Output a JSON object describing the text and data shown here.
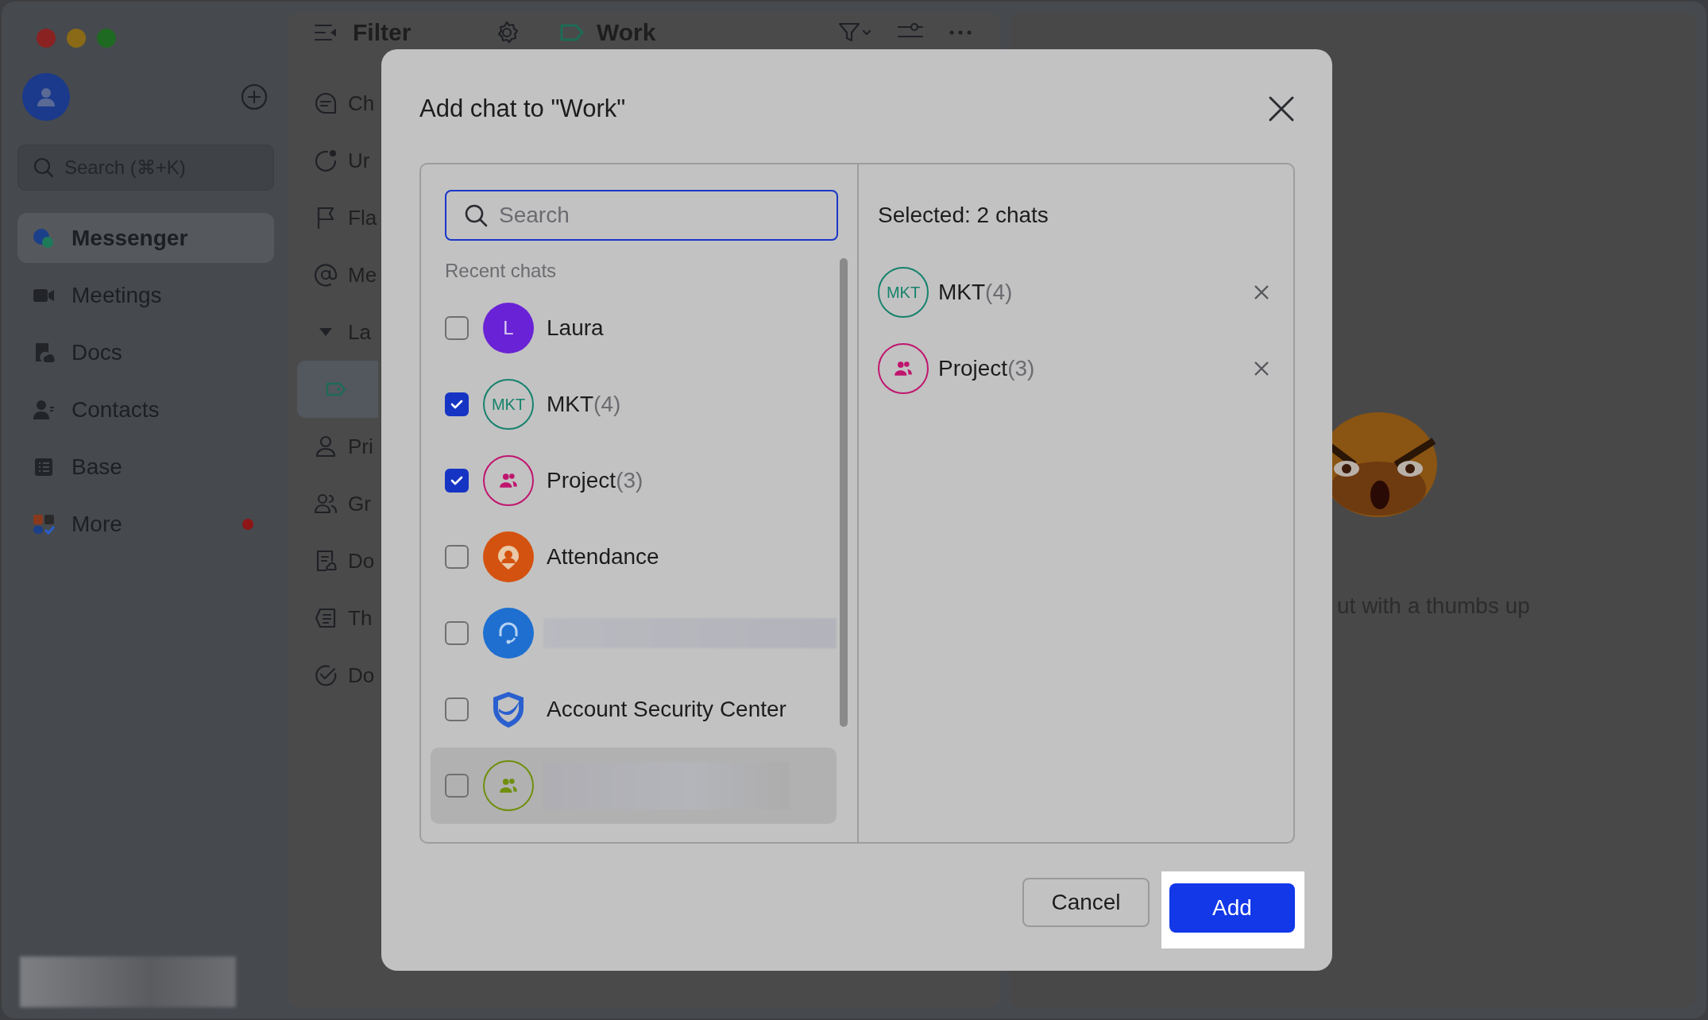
{
  "sidebar": {
    "search": {
      "placeholder": "Search (⌘+K)"
    },
    "items": [
      {
        "label": "Messenger",
        "selected": true,
        "unread_dot": false
      },
      {
        "label": "Meetings",
        "selected": false,
        "unread_dot": false
      },
      {
        "label": "Docs",
        "selected": false,
        "unread_dot": false
      },
      {
        "label": "Contacts",
        "selected": false,
        "unread_dot": false
      },
      {
        "label": "Base",
        "selected": false,
        "unread_dot": false
      },
      {
        "label": "More",
        "selected": false,
        "unread_dot": true
      }
    ]
  },
  "filter_panel": {
    "title": "Filter",
    "items": [
      {
        "label": "Ch",
        "selected": false
      },
      {
        "label": "Ur",
        "selected": false
      },
      {
        "label": "Fla",
        "selected": false
      },
      {
        "label": "Me",
        "selected": false
      },
      {
        "label": "La",
        "selected": false,
        "expanded": true,
        "children": [
          {
            "selected": true
          }
        ]
      },
      {
        "label": "Pri",
        "selected": false
      },
      {
        "label": "Gr",
        "selected": false
      },
      {
        "label": "Do",
        "selected": false
      },
      {
        "label": "Th",
        "selected": false
      },
      {
        "label": "Do",
        "selected": false
      }
    ]
  },
  "conversation": {
    "title": "Work"
  },
  "empty_state": {
    "text": "ut with a thumbs up"
  },
  "dialog": {
    "title": "Add chat to \"Work\"",
    "search": {
      "placeholder": "Search"
    },
    "section_label": "Recent chats",
    "chats": [
      {
        "name": "Laura",
        "avatar": {
          "kind": "initial",
          "text": "L",
          "color": "#6a22d6"
        },
        "checked": false,
        "hovered": false
      },
      {
        "name": "MKT",
        "count": "(4)",
        "avatar": {
          "kind": "ring-text",
          "text": "MKT",
          "color": "#16826c"
        },
        "checked": true,
        "hovered": false
      },
      {
        "name": "Project",
        "count": "(3)",
        "avatar": {
          "kind": "ring-group",
          "color": "#c0156e"
        },
        "checked": true,
        "hovered": false
      },
      {
        "name": "Attendance",
        "avatar": {
          "kind": "attendance",
          "color": "#d4520f"
        },
        "checked": false,
        "hovered": false
      },
      {
        "avatar": {
          "kind": "support",
          "color": "#1e6fd0"
        },
        "checked": false,
        "hovered": false,
        "blurred": true
      },
      {
        "name": "Account Security Center",
        "avatar": {
          "kind": "shield",
          "color": "#2a5fcf"
        },
        "checked": false,
        "hovered": false
      },
      {
        "avatar": {
          "kind": "ring-group",
          "color": "#6f8f0c"
        },
        "checked": false,
        "hovered": true,
        "blurred": true
      }
    ],
    "selected_header": "Selected: 2 chats",
    "selected": [
      {
        "name": "MKT",
        "count": "(4)",
        "avatar": {
          "kind": "ring-text",
          "text": "MKT",
          "color": "#16826c"
        }
      },
      {
        "name": "Project",
        "count": "(3)",
        "avatar": {
          "kind": "ring-group",
          "color": "#c0156e"
        }
      }
    ],
    "buttons": [
      {
        "label": "Cancel",
        "kind": "secondary"
      },
      {
        "label": "Add",
        "kind": "primary",
        "highlighted": true
      }
    ]
  }
}
